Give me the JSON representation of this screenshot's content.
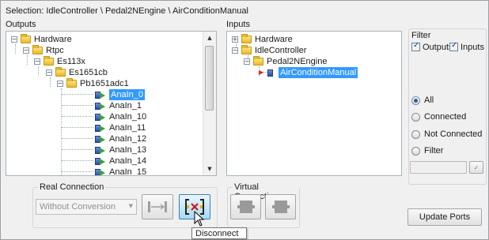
{
  "selection": "Selection: IdleController \\ Pedal2NEngine \\ AirConditionManual",
  "outputs": {
    "label": "Outputs",
    "nodes": [
      {
        "label": "Hardware",
        "kind": "folder",
        "exp": "−"
      },
      {
        "label": "Rtpc",
        "kind": "folder",
        "exp": "−"
      },
      {
        "label": "Es113x",
        "kind": "folder",
        "exp": "−"
      },
      {
        "label": "Es1651cb",
        "kind": "folder",
        "exp": "−"
      },
      {
        "label": "Pb1651adc1",
        "kind": "folder",
        "exp": "−"
      },
      {
        "label": "AnaIn_0",
        "kind": "port",
        "selected": true
      },
      {
        "label": "AnaIn_1",
        "kind": "port"
      },
      {
        "label": "AnaIn_10",
        "kind": "port"
      },
      {
        "label": "AnaIn_11",
        "kind": "port"
      },
      {
        "label": "AnaIn_12",
        "kind": "port"
      },
      {
        "label": "AnaIn_13",
        "kind": "port"
      },
      {
        "label": "AnaIn_14",
        "kind": "port"
      },
      {
        "label": "AnaIn_15",
        "kind": "port"
      }
    ]
  },
  "inputs": {
    "label": "Inputs",
    "nodes": [
      {
        "label": "Hardware",
        "kind": "folder",
        "exp": "+"
      },
      {
        "label": "IdleController",
        "kind": "folder",
        "exp": "−"
      },
      {
        "label": "Pedal2NEngine",
        "kind": "folder",
        "exp": "−"
      },
      {
        "label": "AirConditionManual",
        "kind": "port",
        "selected": true
      }
    ]
  },
  "filter": {
    "label": "Filter",
    "outputs_label": "Outputs",
    "inputs_label": "Inputs",
    "outputs_checked": true,
    "inputs_checked": true,
    "radios": [
      "All",
      "Connected",
      "Not Connected",
      "Filter"
    ],
    "selected_radio": "All"
  },
  "real_connection": {
    "label": "Real Connection",
    "conversion_value": "Without Conversion"
  },
  "virtual_connection": {
    "label": "Virtual Connection"
  },
  "update_ports_label": "Update Ports",
  "tooltip": "Disconnect",
  "colors": {
    "selection": "#3399ff",
    "panel": "#f0f0f0",
    "hot_button": "#a7d9f5"
  }
}
